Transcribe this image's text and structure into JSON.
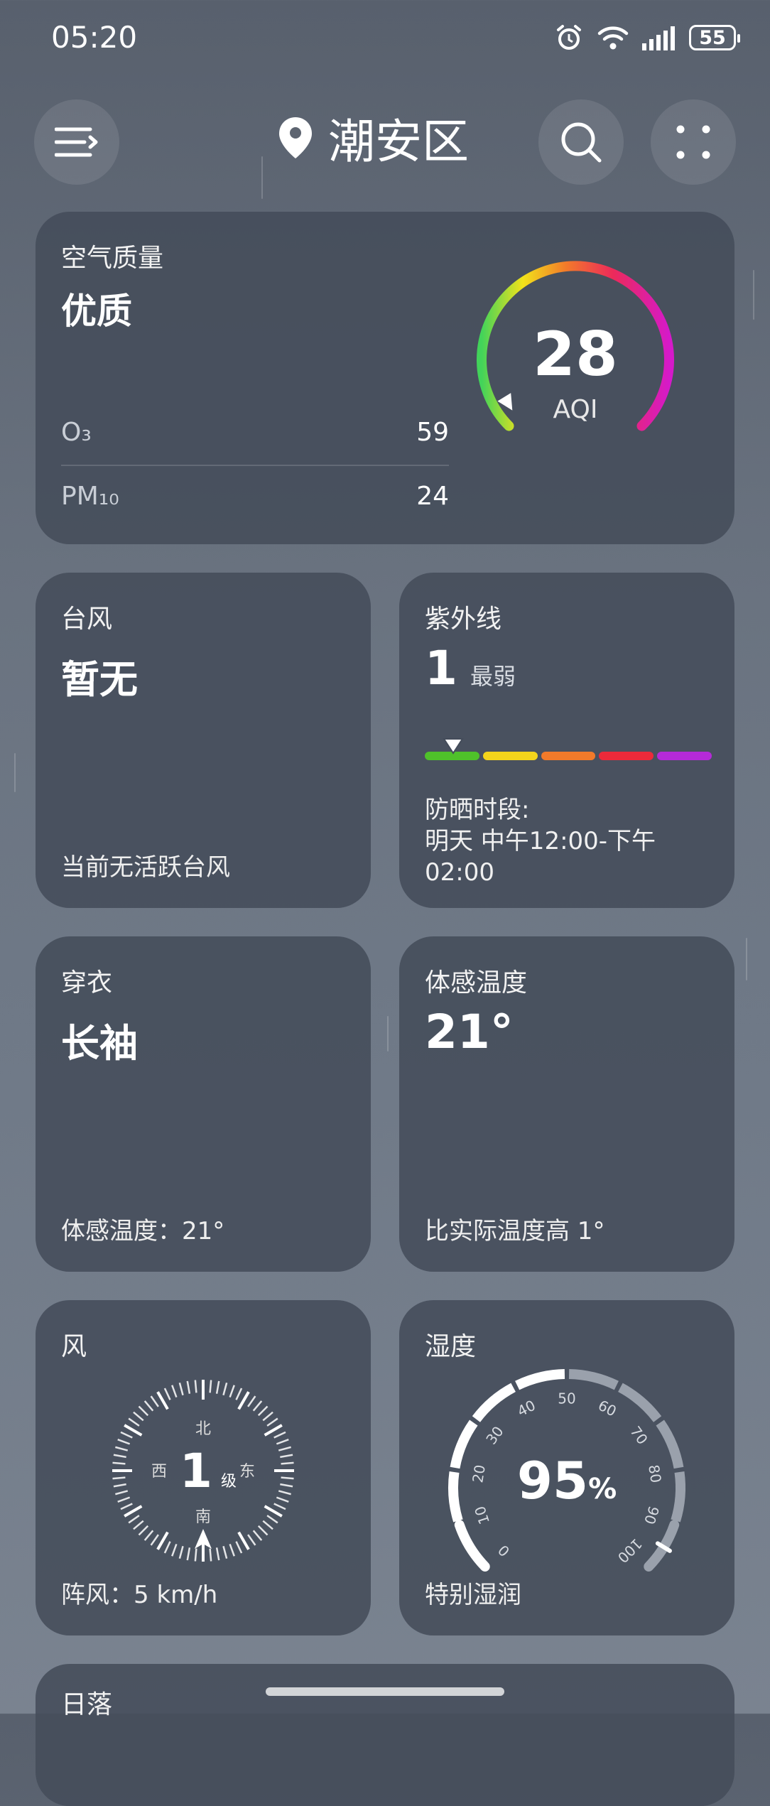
{
  "status": {
    "time": "05:20",
    "battery": "55",
    "icons": [
      "alarm-icon",
      "wifi-icon",
      "signal-icon",
      "battery-icon"
    ]
  },
  "header": {
    "location": "潮安区",
    "icons": [
      "menu-icon",
      "location-pin-icon",
      "search-icon",
      "more-icon"
    ]
  },
  "air": {
    "title": "空气质量",
    "level": "优质",
    "rows": [
      {
        "label": "O₃",
        "value": "59"
      },
      {
        "label": "PM₁₀",
        "value": "24"
      }
    ],
    "aqi_value": "28",
    "aqi_label": "AQI",
    "gauge_fraction": 0.05
  },
  "typhoon": {
    "title": "台风",
    "value": "暂无",
    "footer": "当前无活跃台风"
  },
  "uv": {
    "title": "紫外线",
    "value": "1",
    "level": "最弱",
    "scale_colors": [
      "#4fc12a",
      "#f4d41b",
      "#f27a2a",
      "#ec2a3a",
      "#b52ad8"
    ],
    "marker_fraction": 0.1,
    "sun_label": "防晒时段:",
    "sun_time": "明天 中午12:00-下午02:00"
  },
  "clothing": {
    "title": "穿衣",
    "value": "长袖",
    "footer": "体感温度：21°"
  },
  "feels": {
    "title": "体感温度",
    "value": "21°",
    "footer": "比实际温度高 1°"
  },
  "wind": {
    "title": "风",
    "level": "1",
    "unit": "级",
    "directions": {
      "n": "北",
      "s": "南",
      "e": "东",
      "w": "西"
    },
    "footer": "阵风：5 km/h"
  },
  "humidity": {
    "title": "湿度",
    "value": "95",
    "unit": "%",
    "ticks": [
      "0",
      "10",
      "20",
      "30",
      "40",
      "50",
      "60",
      "70",
      "80",
      "90",
      "100"
    ],
    "footer": "特别湿润"
  },
  "sunset": {
    "title": "日落"
  }
}
